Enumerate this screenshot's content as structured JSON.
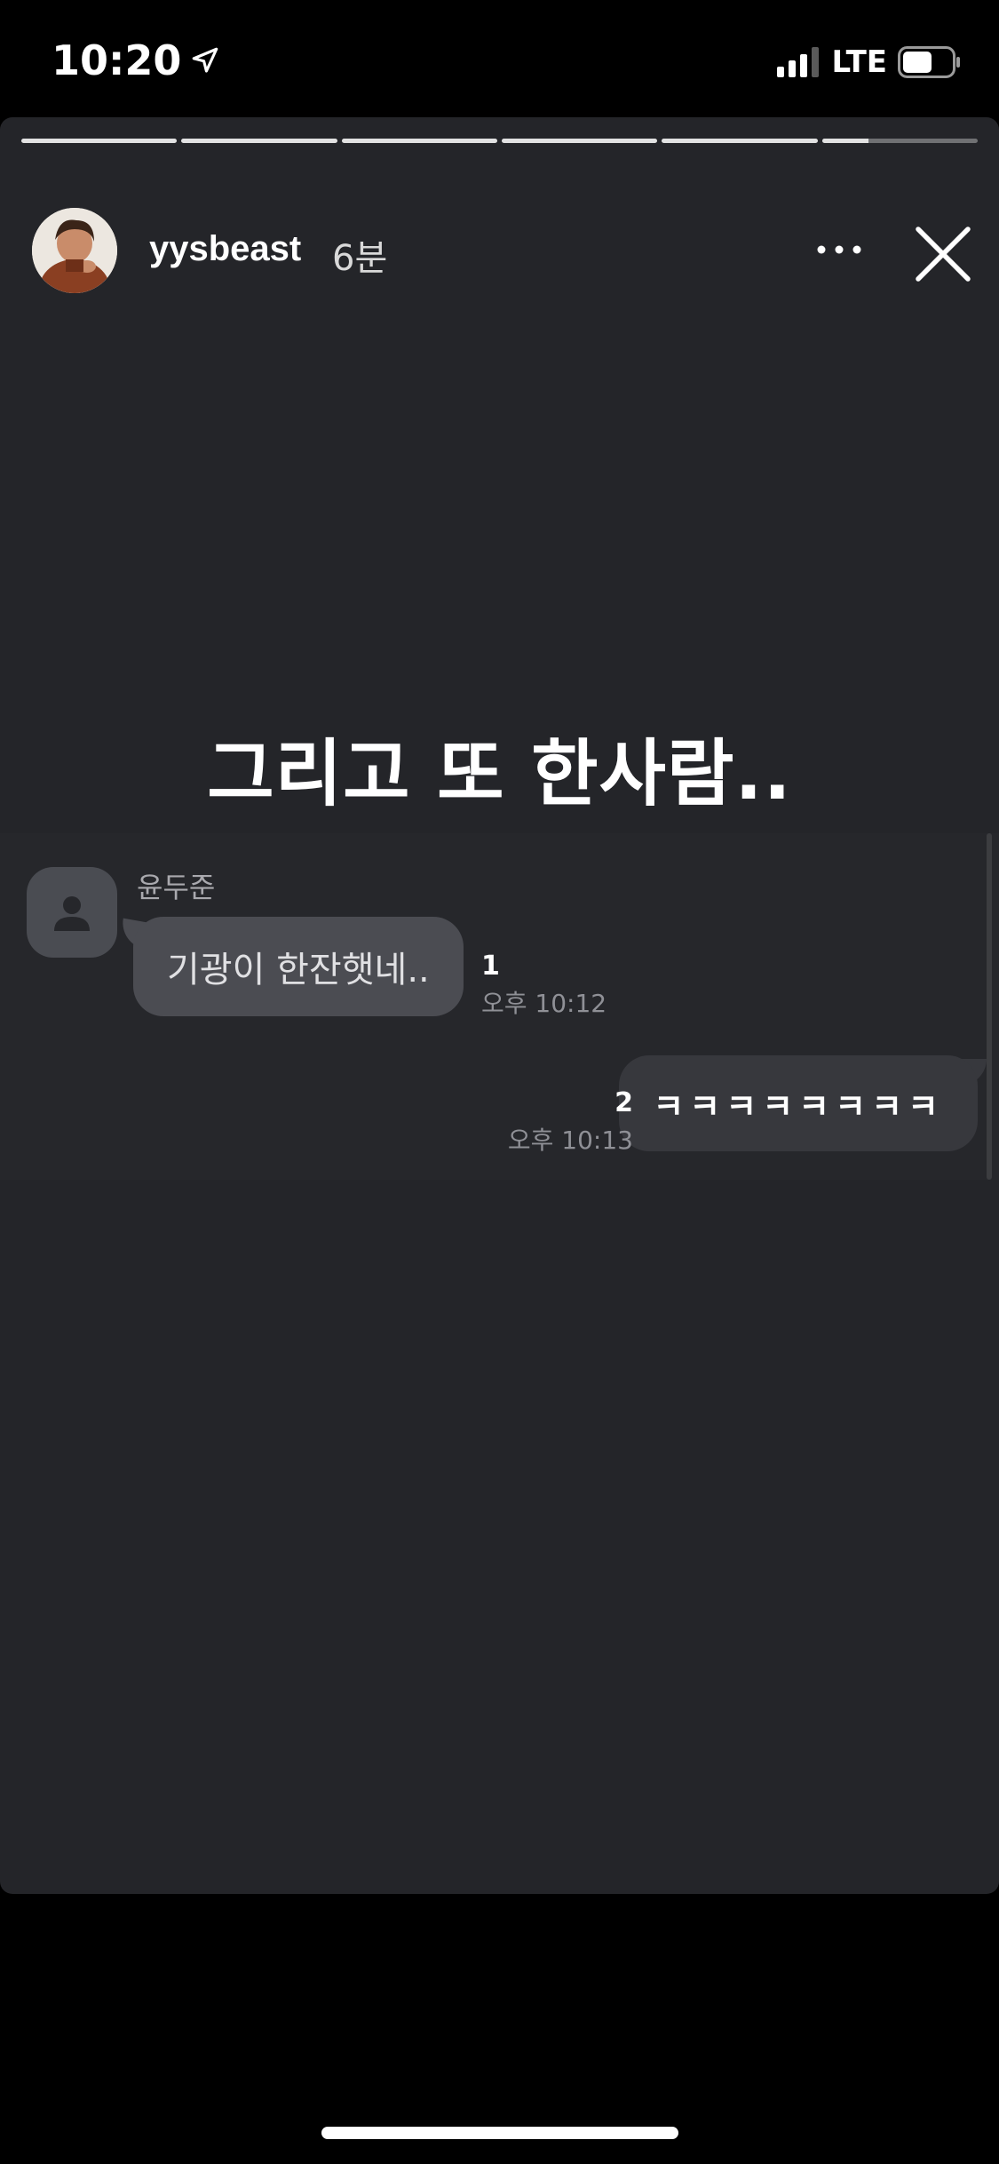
{
  "status_bar": {
    "time": "10:20",
    "network": "LTE",
    "location_icon": "location-arrow-icon",
    "signal_icon": "cellular-signal-icon",
    "battery_icon": "battery-icon",
    "battery_level": 0.6
  },
  "story": {
    "progress": {
      "segment_count": 6,
      "current_segment_fill": 0.3
    },
    "header": {
      "username": "yysbeast",
      "time_ago": "6분",
      "more_icon": "more-dots-icon",
      "close_icon": "close-icon"
    },
    "caption": "그리고 또 한사람.."
  },
  "chat": {
    "incoming": {
      "sender": "윤두준",
      "message": "기광이 한잔햇네..",
      "unread": "1",
      "timestamp": "오후 10:12"
    },
    "outgoing": {
      "message": "ㅋㅋㅋㅋㅋㅋㅋㅋ",
      "unread": "2",
      "timestamp": "오후 10:13"
    }
  },
  "colors": {
    "story_background": "#242529",
    "incoming_bubble": "#4b4c52",
    "outgoing_bubble": "#37383d",
    "timestamp": "#8f9096"
  }
}
